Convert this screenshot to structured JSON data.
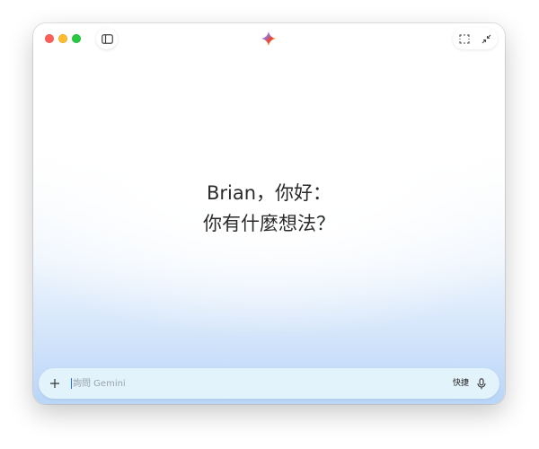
{
  "window": {
    "controls": [
      "close",
      "minimize",
      "zoom"
    ],
    "toolbar": {
      "sidebar_icon": "sidebar-toggle-icon",
      "logo_icon": "gemini-sparkle-icon",
      "screenshot_icon": "screen-capture-icon",
      "collapse_icon": "collapse-icon"
    }
  },
  "greeting": {
    "line1": "Brian，你好：",
    "line2": "你有什麼想法？"
  },
  "composer": {
    "add_icon": "plus-icon",
    "placeholder": "詢問 Gemini",
    "value": "",
    "shortcut_label": "快捷",
    "mic_icon": "microphone-icon"
  },
  "colors": {
    "accent_caret": "#1a73e8",
    "input_background": "#e3f3fb",
    "gradient_bottom": "#b9d6f8"
  }
}
